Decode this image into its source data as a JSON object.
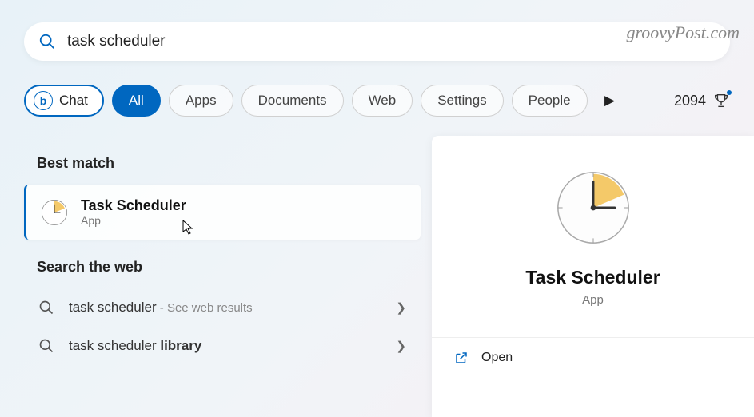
{
  "watermark": "groovyPost.com",
  "search": {
    "value": "task scheduler"
  },
  "filters": {
    "chat": "Chat",
    "items": [
      "All",
      "Apps",
      "Documents",
      "Web",
      "Settings",
      "People"
    ],
    "activeIndex": 0
  },
  "rewards": {
    "points": "2094"
  },
  "bestMatch": {
    "heading": "Best match",
    "title": "Task Scheduler",
    "subtitle": "App"
  },
  "webSearch": {
    "heading": "Search the web",
    "items": [
      {
        "text": "task scheduler",
        "suffix": " - See web results",
        "bold": ""
      },
      {
        "text": "task scheduler ",
        "suffix": "",
        "bold": "library"
      }
    ]
  },
  "panel": {
    "title": "Task Scheduler",
    "subtitle": "App",
    "actions": {
      "open": "Open"
    }
  }
}
